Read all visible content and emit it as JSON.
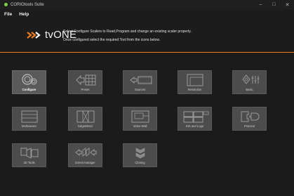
{
  "window": {
    "title": "CORIOtools Suite",
    "minimize": "–",
    "maximize": "□",
    "close": "✕"
  },
  "menu": {
    "file": "File",
    "help": "Help"
  },
  "header": {
    "brand": "tvONE",
    "instruction_1": "Select Configure Scalers to Read,Program and change an existing scaler property.",
    "instruction_2": "Once configured select the required Tool from the icons below."
  },
  "colors": {
    "accent": "#f07c1f",
    "tile": "#4c4c4c",
    "background": "#1b1b1b"
  },
  "tools": [
    {
      "label": "Configure",
      "icon": "gears-icon",
      "active": true
    },
    {
      "label": "Preset",
      "icon": "preset-icon",
      "active": false
    },
    {
      "label": "Sources",
      "icon": "sources-icon",
      "active": false
    },
    {
      "label": "Resolution",
      "icon": "resolution-icon",
      "active": false
    },
    {
      "label": "Basic",
      "icon": "basic-adjust-icon",
      "active": false
    },
    {
      "label": "Multiviewer",
      "icon": "multiviewer-icon",
      "active": false
    },
    {
      "label": "EdgeBlend",
      "icon": "edgeblend-icon",
      "active": false
    },
    {
      "label": "Video Wall",
      "icon": "video-wall-icon",
      "active": false
    },
    {
      "label": "SIS and Logo",
      "icon": "sis-logo-icon",
      "active": false
    },
    {
      "label": "Protocol",
      "icon": "protocol-icon",
      "active": false
    },
    {
      "label": "3D Tools",
      "icon": "3d-tools-icon",
      "active": false
    },
    {
      "label": "Event manager",
      "icon": "event-manager-icon",
      "active": false
    },
    {
      "label": "Cloning",
      "icon": "cloning-icon",
      "active": false
    }
  ]
}
